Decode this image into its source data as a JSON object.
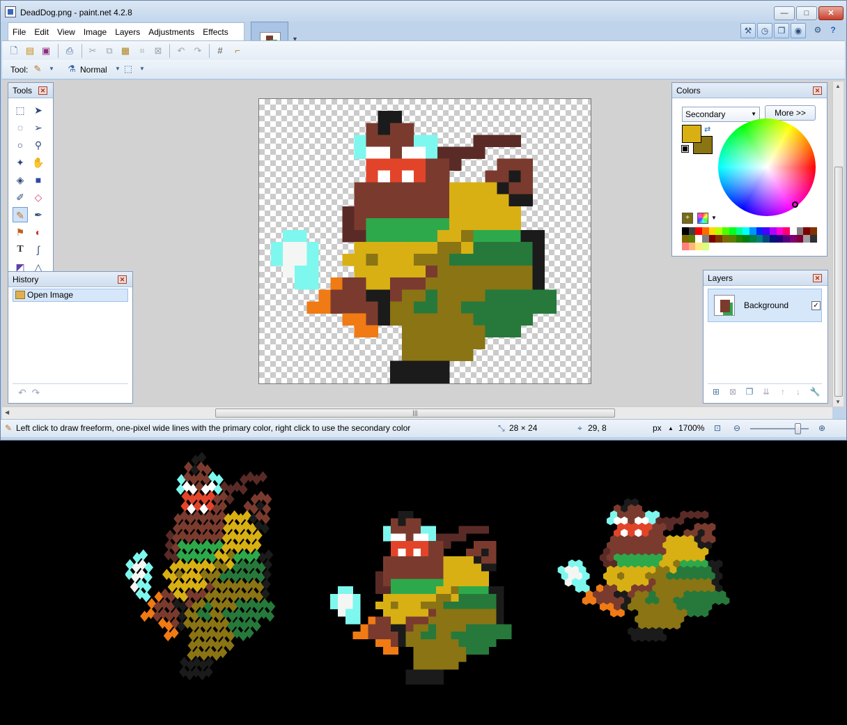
{
  "window": {
    "title": "DeadDog.png - paint.net 4.2.8",
    "minimize": "—",
    "maximize": "□",
    "close": "✕"
  },
  "menu": [
    "File",
    "Edit",
    "View",
    "Image",
    "Layers",
    "Adjustments",
    "Effects"
  ],
  "toolbar": {
    "tool_label": "Tool:",
    "blend_mode": "Normal"
  },
  "tools_panel": {
    "title": "Tools"
  },
  "history_panel": {
    "title": "History",
    "items": [
      "Open Image"
    ]
  },
  "colors_panel": {
    "title": "Colors",
    "mode": "Secondary",
    "more_button": "More >>",
    "primary_color": "#d8b014",
    "secondary_color": "#8a7414",
    "palette_top": [
      "#000000",
      "#404040",
      "#ff0000",
      "#ff6a00",
      "#ffd800",
      "#b6ff00",
      "#4cff00",
      "#00ff21",
      "#00ff90",
      "#00ffff",
      "#0094ff",
      "#0026ff",
      "#4800ff",
      "#b200ff",
      "#ff00dc",
      "#ff006e",
      "#ffffff",
      "#808080",
      "#7f0000",
      "#7f3300",
      "#7f6a00",
      "#5b7f00"
    ],
    "palette_bottom": [
      "#ffffff",
      "#808080",
      "#7f0000",
      "#7f3300",
      "#7f6a00",
      "#5b7f00",
      "#267f00",
      "#007f0e",
      "#007f46",
      "#007f7f",
      "#004a7f",
      "#00137f",
      "#21007f",
      "#57007f",
      "#7f006e",
      "#7f0037",
      "#a0a0a0",
      "#303030",
      "#ff7f7f",
      "#ffb27f",
      "#ffe97f",
      "#daff7f"
    ]
  },
  "layers_panel": {
    "title": "Layers",
    "layers": [
      {
        "name": "Background",
        "visible": "✓"
      }
    ]
  },
  "status": {
    "hint": "Left click to draw freeform, one-pixel wide lines with the primary color, right click to use the secondary color",
    "image_size": "28 × 24",
    "cursor_pos": "29, 8",
    "units": "px",
    "zoom": "1700%"
  }
}
